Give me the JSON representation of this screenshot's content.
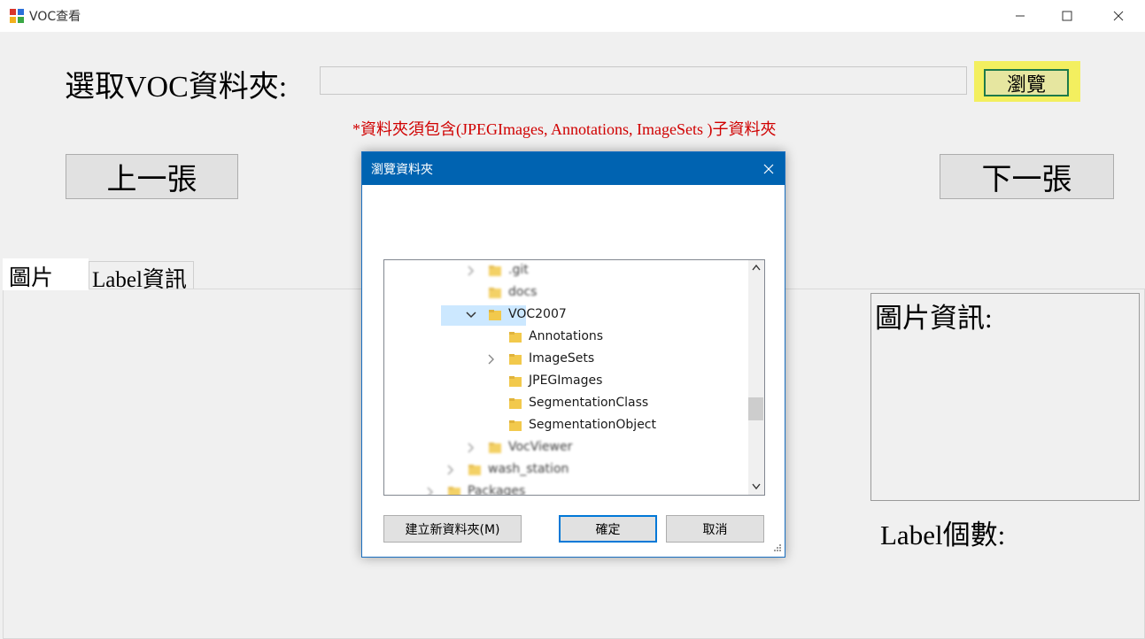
{
  "window": {
    "title": "VOC查看",
    "controls": [
      "minimize-icon",
      "maximize-icon",
      "close-icon"
    ]
  },
  "form": {
    "select_label": "選取VOC資料夾:",
    "path_value": "",
    "browse_label": "瀏覽",
    "hint": "*資料夾須包含(JPEGImages, Annotations, ImageSets )子資料夾",
    "prev_label": "上一張",
    "next_label": "下一張"
  },
  "tabs": [
    {
      "label": "圖片",
      "selected": true
    },
    {
      "label": "Label資訊",
      "selected": false
    }
  ],
  "info": {
    "title": "圖片資訊:",
    "label_count": "Label個數:"
  },
  "dialog": {
    "title": "瀏覽資料夾",
    "tree": [
      {
        "label": ".git",
        "level": 2,
        "expander": "collapsed",
        "blurred": true
      },
      {
        "label": "docs",
        "level": 2,
        "expander": "none",
        "blurred": true
      },
      {
        "label": "VOC2007",
        "level": 2,
        "expander": "expanded",
        "selected": true
      },
      {
        "label": "Annotations",
        "level": 3,
        "expander": "none"
      },
      {
        "label": "ImageSets",
        "level": 3,
        "expander": "collapsed"
      },
      {
        "label": "JPEGImages",
        "level": 3,
        "expander": "none"
      },
      {
        "label": "SegmentationClass",
        "level": 3,
        "expander": "none"
      },
      {
        "label": "SegmentationObject",
        "level": 3,
        "expander": "none"
      },
      {
        "label": "VocViewer",
        "level": 2,
        "expander": "collapsed",
        "blurred": true
      },
      {
        "label": "wash_station",
        "level": 1,
        "expander": "collapsed",
        "blurred": true
      },
      {
        "label": "Packages",
        "level": 0,
        "expander": "collapsed",
        "blurred": true
      }
    ],
    "new_folder_label": "建立新資料夾(M)",
    "ok_label": "確定",
    "cancel_label": "取消"
  },
  "colors": {
    "dialog_titlebar": "#0063b1",
    "hint_text": "#d00000",
    "browse_highlight": "#f3ef5f",
    "selection": "#cce8ff",
    "folder": "#f2c94c"
  }
}
